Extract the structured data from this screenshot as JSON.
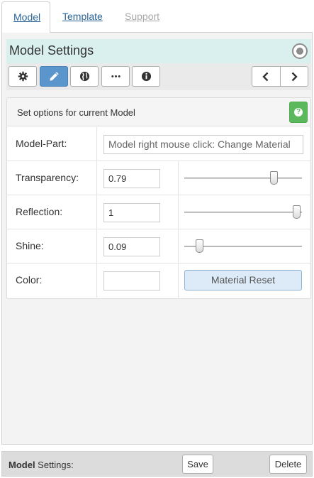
{
  "tabs": [
    {
      "label": "Model",
      "state": "active"
    },
    {
      "label": "Template",
      "state": "link"
    },
    {
      "label": "Support",
      "state": "disabled"
    }
  ],
  "header": {
    "title": "Model Settings",
    "status_icon": "radio-circle-icon"
  },
  "toolbar": {
    "buttons": [
      {
        "icon": "gear-icon",
        "active": false
      },
      {
        "icon": "pencil-icon",
        "active": true
      },
      {
        "icon": "globe-icon",
        "active": false
      },
      {
        "icon": "ellipsis-icon",
        "active": false
      },
      {
        "icon": "info-icon",
        "active": false
      }
    ],
    "nav": [
      "chevron-left-icon",
      "chevron-right-icon"
    ]
  },
  "card": {
    "heading": "Set options for current Model",
    "help_icon": "question-icon",
    "model_part": {
      "label": "Model-Part:",
      "placeholder": "Model right mouse click: Change Material"
    },
    "transparency": {
      "label": "Transparency:",
      "value": "0.79",
      "slider": 0.79
    },
    "reflection": {
      "label": "Reflection:",
      "value": "1",
      "slider": 1
    },
    "shine": {
      "label": "Shine:",
      "value": "0.09",
      "slider": 0.09
    },
    "color": {
      "label": "Color:",
      "value": ""
    },
    "reset_label": "Material Reset"
  },
  "footer": {
    "label_bold": "Model",
    "label_rest": " Settings:",
    "save_label": "Save",
    "delete_label": "Delete"
  },
  "colors": {
    "accent": "#5a95cc",
    "header_bg": "#d9f0ee",
    "help_green": "#5cb85c"
  }
}
